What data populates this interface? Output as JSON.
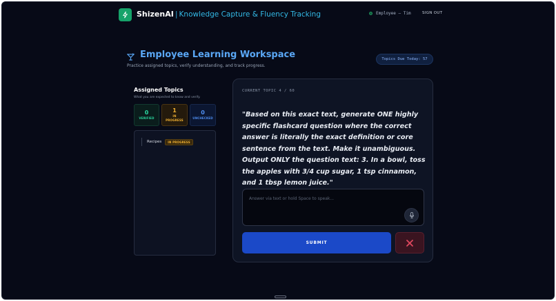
{
  "header": {
    "brand": "ShizenAI",
    "separator": "|",
    "tagline": "Knowledge Capture & Fluency Tracking",
    "user_label": "Employee — Tim",
    "sign_out": "SIGN OUT"
  },
  "page": {
    "title": "Employee Learning Workspace",
    "subtitle": "Practice assigned topics, verify understanding, and track progress.",
    "topics_due": "Topics Due Today: 57"
  },
  "assigned": {
    "heading": "Assigned Topics",
    "subheading": "What you are expected to know and verify.",
    "stats": {
      "verified": {
        "count": "0",
        "label": "VERIFIED"
      },
      "in_progress": {
        "count": "1",
        "label_line1": "IN",
        "label_line2": "PROGRESS"
      },
      "unchecked": {
        "count": "0",
        "label": "UNCHECKED"
      }
    },
    "topics": [
      {
        "name": "Recipes",
        "status": "IN PROGRESS"
      }
    ]
  },
  "current": {
    "label": "CURRENT TOPIC 4 / 60",
    "question": "\"Based on this exact text, generate ONE highly specific flashcard question where the correct answer is literally the exact definition or core sentence from the text. Make it unambiguous. Output ONLY the question text: 3. In a bowl, toss the apples with 3/4 cup sugar, 1 tsp cinnamon, and 1 tbsp lemon juice.\"",
    "answer_placeholder": "Answer via text or hold Space to speak...",
    "answer_value": "",
    "submit_label": "SUBMIT"
  },
  "colors": {
    "background": "#070a17",
    "accent": "#5aa7f5",
    "brand_green": "#16a36a",
    "submit_blue": "#1b49c8",
    "verified": "#2ad8a0",
    "in_progress": "#f2b233",
    "unchecked": "#4f8ff3",
    "danger": "#e0475f"
  },
  "icons": {
    "logo": "sparkle-icon",
    "title": "cocktail-icon",
    "mic": "microphone-icon",
    "close": "close-icon"
  }
}
